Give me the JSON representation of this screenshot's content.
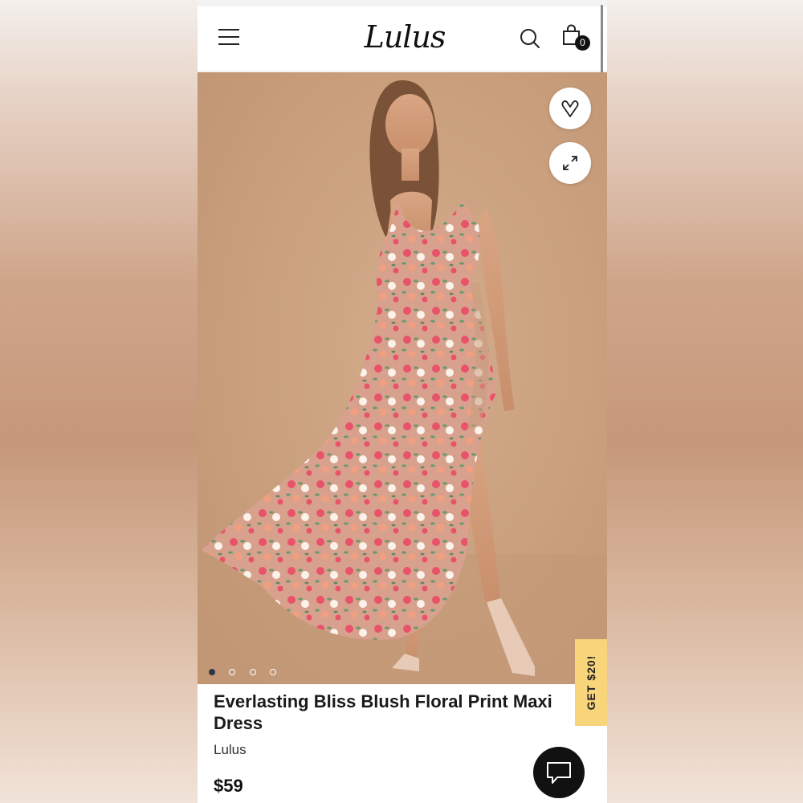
{
  "header": {
    "logo_text": "Lulus",
    "cart_count": "0"
  },
  "hero": {
    "image_alt": "Model wearing floral print maxi dress",
    "carousel_total": 4,
    "carousel_active": 1
  },
  "promo": {
    "label": "GET $20!"
  },
  "product": {
    "title": "Everlasting Bliss Blush Floral Print Maxi Dress",
    "brand": "Lulus",
    "price": "$59"
  },
  "colors": {
    "background_blush": "#c99f7d",
    "promo_yellow": "#f8d57a",
    "active_dot": "#2f3540",
    "text_dark": "#1a1a1a"
  },
  "icons": {
    "menu": "hamburger-icon",
    "search": "search-icon",
    "cart": "shopping-bag-icon",
    "wishlist": "heart-icon",
    "expand": "expand-icon",
    "chat": "chat-icon"
  }
}
